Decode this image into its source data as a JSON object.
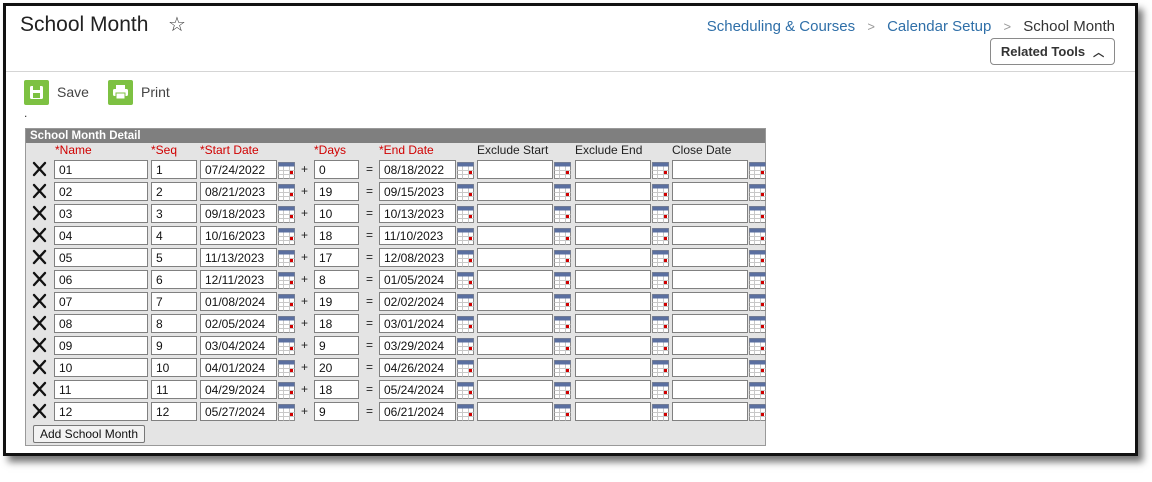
{
  "header": {
    "title": "School Month",
    "breadcrumb": [
      "Scheduling & Courses",
      "Calendar Setup"
    ],
    "breadcrumb_current": "School Month",
    "related_tools_label": "Related Tools"
  },
  "toolbar": {
    "save_label": "Save",
    "print_label": "Print",
    "dot": "."
  },
  "panel": {
    "title": "School Month Detail",
    "columns": {
      "name": "*Name",
      "seq": "*Seq",
      "start": "*Start Date",
      "days": "*Days",
      "end": "*End Date",
      "exclude_start": "Exclude Start",
      "exclude_end": "Exclude End",
      "close": "Close Date"
    },
    "plus": "+",
    "equals": "=",
    "add_label": "Add School Month"
  },
  "rows": [
    {
      "name": "01",
      "seq": "1",
      "start": "07/24/2022",
      "days": "0",
      "end": "08/18/2022",
      "exclude_start": "",
      "exclude_end": "",
      "close": ""
    },
    {
      "name": "02",
      "seq": "2",
      "start": "08/21/2023",
      "days": "19",
      "end": "09/15/2023",
      "exclude_start": "",
      "exclude_end": "",
      "close": ""
    },
    {
      "name": "03",
      "seq": "3",
      "start": "09/18/2023",
      "days": "10",
      "end": "10/13/2023",
      "exclude_start": "",
      "exclude_end": "",
      "close": ""
    },
    {
      "name": "04",
      "seq": "4",
      "start": "10/16/2023",
      "days": "18",
      "end": "11/10/2023",
      "exclude_start": "",
      "exclude_end": "",
      "close": ""
    },
    {
      "name": "05",
      "seq": "5",
      "start": "11/13/2023",
      "days": "17",
      "end": "12/08/2023",
      "exclude_start": "",
      "exclude_end": "",
      "close": ""
    },
    {
      "name": "06",
      "seq": "6",
      "start": "12/11/2023",
      "days": "8",
      "end": "01/05/2024",
      "exclude_start": "",
      "exclude_end": "",
      "close": ""
    },
    {
      "name": "07",
      "seq": "7",
      "start": "01/08/2024",
      "days": "19",
      "end": "02/02/2024",
      "exclude_start": "",
      "exclude_end": "",
      "close": ""
    },
    {
      "name": "08",
      "seq": "8",
      "start": "02/05/2024",
      "days": "18",
      "end": "03/01/2024",
      "exclude_start": "",
      "exclude_end": "",
      "close": ""
    },
    {
      "name": "09",
      "seq": "9",
      "start": "03/04/2024",
      "days": "9",
      "end": "03/29/2024",
      "exclude_start": "",
      "exclude_end": "",
      "close": ""
    },
    {
      "name": "10",
      "seq": "10",
      "start": "04/01/2024",
      "days": "20",
      "end": "04/26/2024",
      "exclude_start": "",
      "exclude_end": "",
      "close": ""
    },
    {
      "name": "11",
      "seq": "11",
      "start": "04/29/2024",
      "days": "18",
      "end": "05/24/2024",
      "exclude_start": "",
      "exclude_end": "",
      "close": ""
    },
    {
      "name": "12",
      "seq": "12",
      "start": "05/27/2024",
      "days": "9",
      "end": "06/21/2024",
      "exclude_start": "",
      "exclude_end": "",
      "close": ""
    }
  ],
  "icons": {
    "star": "star-outline-icon",
    "breadcrumb_sep": "chevron-right-icon",
    "related": "chevron-up-icon",
    "save": "floppy-disk-icon",
    "print": "printer-icon",
    "delete": "delete-x-icon",
    "calendar": "calendar-icon"
  },
  "colors": {
    "accent_green": "#7dc142",
    "link_blue": "#2f6fa8",
    "required_red": "#d00000",
    "panel_header": "#7f7f7f",
    "panel_bg": "#e4e4e4"
  }
}
